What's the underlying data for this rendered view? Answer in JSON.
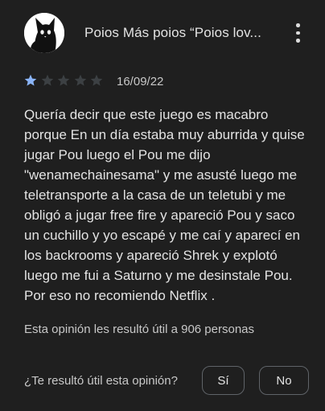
{
  "review": {
    "author": "Poios Más poios “Poios lov...",
    "rating": 1,
    "max_rating": 5,
    "date": "16/09/22",
    "body": "Quería decir que este juego es macabro porque En un día estaba muy aburrida y quise jugar Pou luego el Pou me dijo \"wenamechainesama\" y me asusté luego me teletransporte a la casa de un teletubi y me obligó a jugar free fire y apareció Pou y saco un cuchillo y yo escapé y me caí y aparecí en los backrooms y apareció Shrek y explotó luego me fui a Saturno y me desinstale Pou. Por eso no recomiendo Netflix .",
    "helpful_count": "Esta opinión les resultó útil a 906 personas"
  },
  "feedback": {
    "question": "¿Te resultó útil esta opinión?",
    "yes_label": "Sí",
    "no_label": "No"
  },
  "colors": {
    "background": "#1f1f1f",
    "star_filled": "#8ab4f8",
    "star_empty": "#3c4043",
    "text": "#e3e3e3"
  },
  "icons": {
    "avatar": "black-cat-avatar",
    "menu": "more-vert-icon",
    "star": "star-icon"
  }
}
